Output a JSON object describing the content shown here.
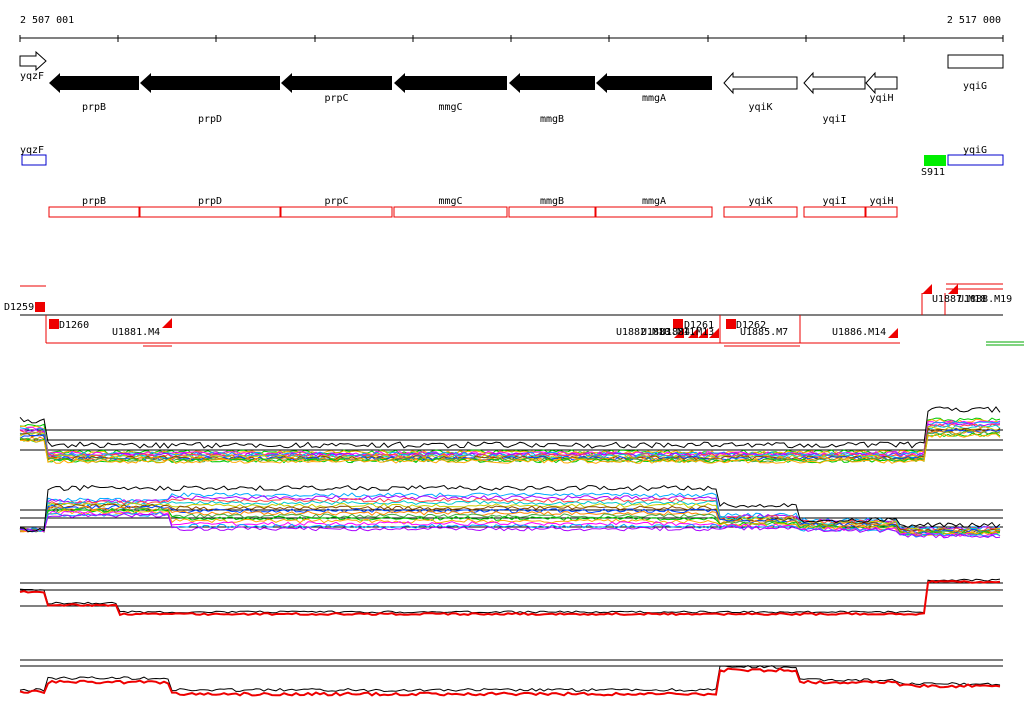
{
  "axis": {
    "start_label": "2 507 001",
    "end_label": "2 517 000",
    "start": 2507001,
    "end": 2517000
  },
  "genes_filled": [
    {
      "label": "prpB",
      "strand": "-"
    },
    {
      "label": "prpD",
      "strand": "-"
    },
    {
      "label": "prpC",
      "strand": "-"
    },
    {
      "label": "mmgC",
      "strand": "-"
    },
    {
      "label": "mmgB",
      "strand": "-"
    },
    {
      "label": "mmgA",
      "strand": "-"
    }
  ],
  "genes_open": [
    {
      "label": "yqzF",
      "strand": "+"
    },
    {
      "label": "yqiK",
      "strand": "-"
    },
    {
      "label": "yqiI",
      "strand": "-"
    },
    {
      "label": "yqiH",
      "strand": "-"
    },
    {
      "label": "yqiG",
      "strand": "+"
    }
  ],
  "blue_features": [
    {
      "label": "yqzF"
    },
    {
      "label": "yqiG"
    }
  ],
  "green_feature": {
    "label": "S911",
    "color": "#00ee00"
  },
  "red_features": [
    "prpB",
    "prpD",
    "prpC",
    "mmgC",
    "mmgB",
    "mmgA",
    "yqiK",
    "yqiI",
    "yqiH"
  ],
  "segments": {
    "upper": [
      "D1259",
      "U1887.M18",
      "U1888.M19"
    ],
    "lower": [
      "D1260",
      "U1881.M4",
      "U1882.M10",
      "U1883.M11",
      "U1884.M13",
      "D1261",
      "D1262",
      "U1885.M7",
      "U1886.M14"
    ]
  },
  "colors": {
    "filled_gene": "#000000",
    "blue_feature": "#0000cc",
    "red_feature": "#ee0000",
    "green_feature": "#00ee00",
    "track_line": "#000000"
  },
  "icons": [
    "filled-arrow-icon",
    "open-arrow-icon",
    "red-flag-icon"
  ]
}
